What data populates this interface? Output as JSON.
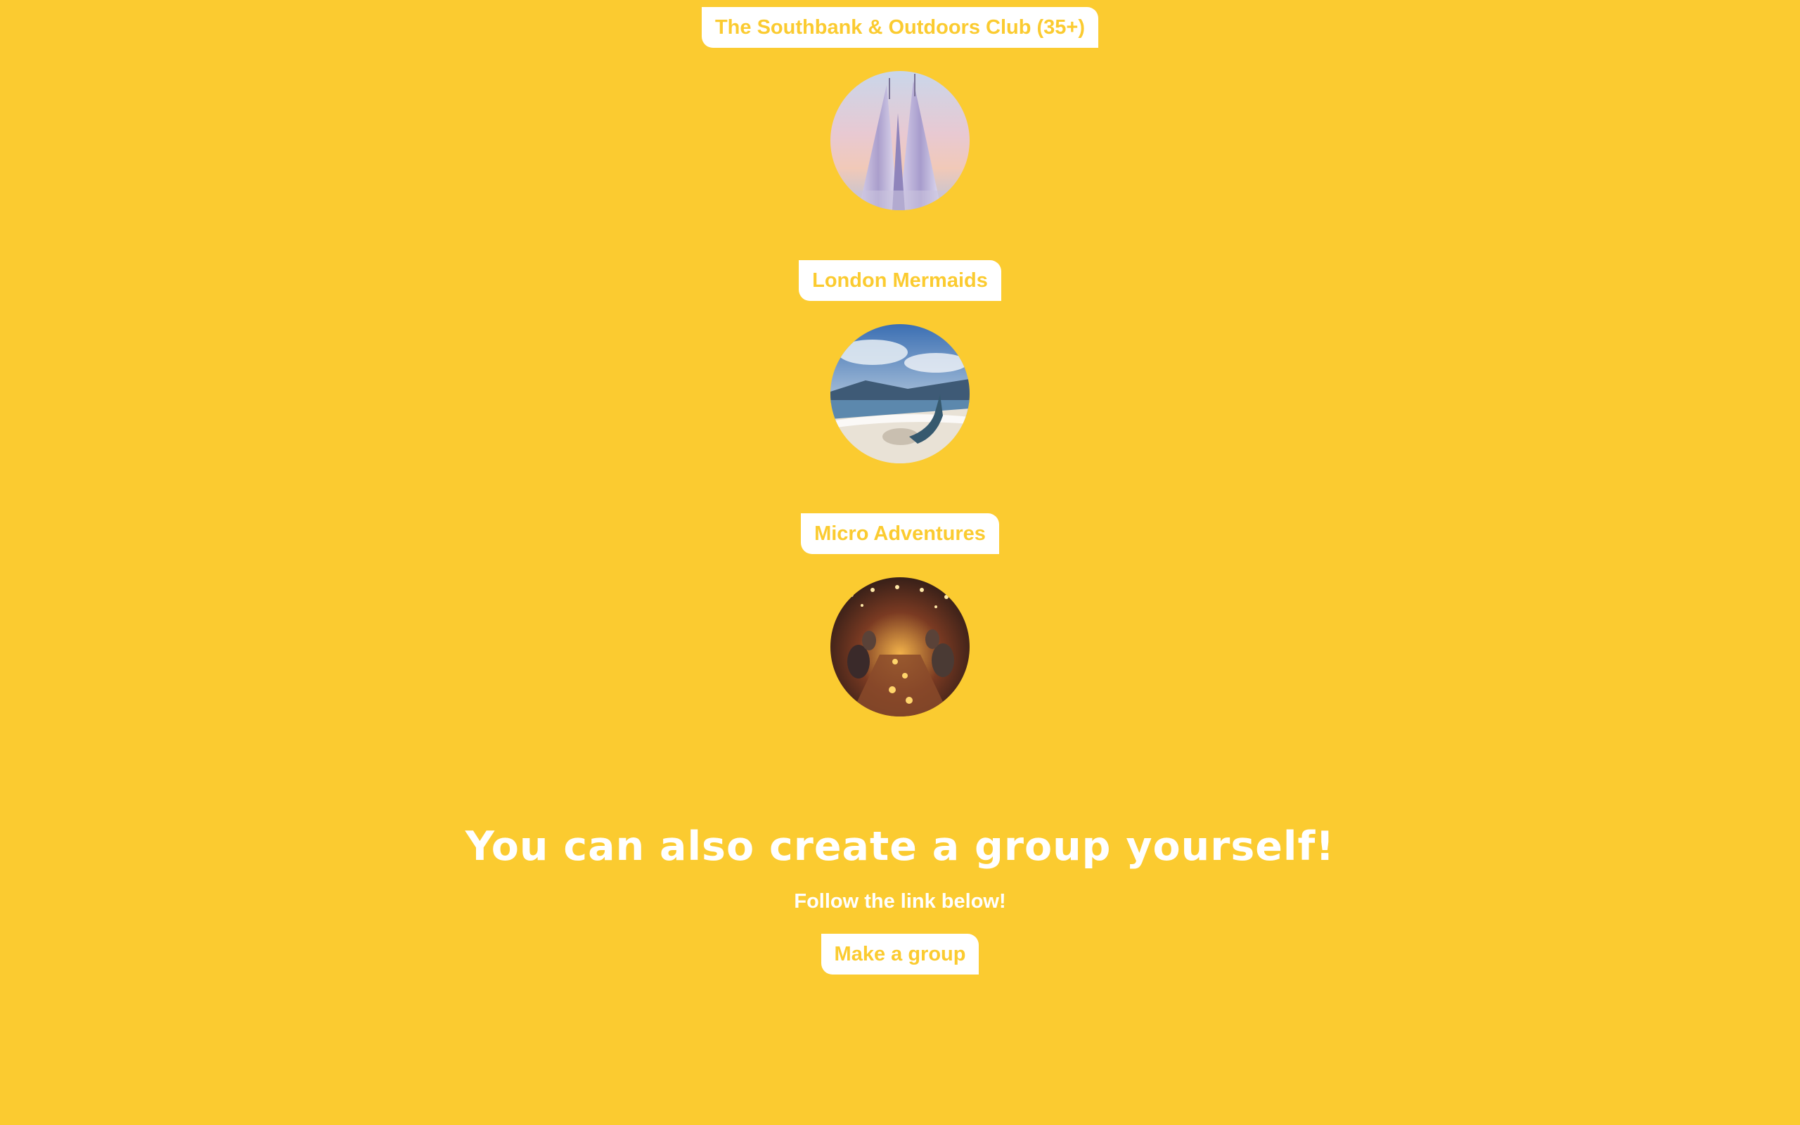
{
  "groups": [
    {
      "name": "The Southbank & Outdoors Club (35+)",
      "image": "shard-skyscraper-photo"
    },
    {
      "name": "London Mermaids",
      "image": "mermaid-on-beach-photo"
    },
    {
      "name": "Micro Adventures",
      "image": "outdoor-dinner-party-photo"
    }
  ],
  "cta": {
    "title": "You can also create a group yourself!",
    "subtitle": "Follow the link below!",
    "button_label": "Make a group"
  },
  "colors": {
    "background": "#FBCB30",
    "pill_background": "#FFFFFF",
    "pill_text": "#FBCB30",
    "heading_text": "#FFFFFF"
  }
}
